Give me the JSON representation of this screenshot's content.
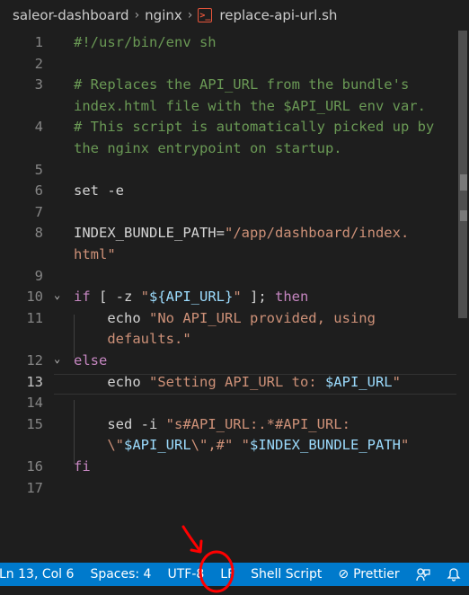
{
  "breadcrumb": {
    "folder": "saleor-dashboard",
    "subfolder": "nginx",
    "file": "replace-api-url.sh"
  },
  "editor": {
    "active_line": "13",
    "lines": [
      {
        "n": "1",
        "code": [
          {
            "t": "cm",
            "v": "#!/usr/bin/env sh"
          }
        ]
      },
      {
        "n": "2",
        "code": []
      },
      {
        "n": "3",
        "code": [
          {
            "t": "cm",
            "v": "# Replaces the API_URL from the bundle's"
          }
        ]
      },
      {
        "n": "",
        "code": [
          {
            "t": "cm",
            "v": "index.html file with the $API_URL env var."
          }
        ]
      },
      {
        "n": "4",
        "code": [
          {
            "t": "cm",
            "v": "# This script is automatically picked up by"
          }
        ]
      },
      {
        "n": "",
        "code": [
          {
            "t": "cm",
            "v": "the nginx entrypoint on startup."
          }
        ]
      },
      {
        "n": "5",
        "code": []
      },
      {
        "n": "6",
        "code": [
          {
            "t": "txt",
            "v": "set -e"
          }
        ]
      },
      {
        "n": "7",
        "code": []
      },
      {
        "n": "8",
        "code": [
          {
            "t": "txt",
            "v": "INDEX_BUNDLE_PATH="
          },
          {
            "t": "str",
            "v": "\"/app/dashboard/index."
          }
        ]
      },
      {
        "n": "",
        "code": [
          {
            "t": "str",
            "v": "html\""
          }
        ]
      },
      {
        "n": "9",
        "code": []
      },
      {
        "n": "10",
        "fold": true,
        "code": [
          {
            "t": "kw",
            "v": "if"
          },
          {
            "t": "txt",
            "v": " [ -z "
          },
          {
            "t": "str",
            "v": "\""
          },
          {
            "t": "var",
            "v": "${API_URL}"
          },
          {
            "t": "str",
            "v": "\""
          },
          {
            "t": "txt",
            "v": " ]; "
          },
          {
            "t": "kw",
            "v": "then"
          }
        ]
      },
      {
        "n": "11",
        "code": [
          {
            "t": "txt",
            "v": "    echo "
          },
          {
            "t": "str",
            "v": "\"No API_URL provided, using"
          }
        ]
      },
      {
        "n": "",
        "code": [
          {
            "t": "str",
            "v": "    defaults.\""
          }
        ]
      },
      {
        "n": "12",
        "fold": true,
        "code": [
          {
            "t": "kw",
            "v": "else"
          }
        ]
      },
      {
        "n": "13",
        "code": [
          {
            "t": "txt",
            "v": "    echo "
          },
          {
            "t": "str",
            "v": "\"Setting API_URL to: "
          },
          {
            "t": "var",
            "v": "$API_URL"
          },
          {
            "t": "str",
            "v": "\""
          }
        ]
      },
      {
        "n": "14",
        "code": []
      },
      {
        "n": "15",
        "code": [
          {
            "t": "txt",
            "v": "    sed -i "
          },
          {
            "t": "str",
            "v": "\"s#API_URL:.*#API_URL:"
          }
        ]
      },
      {
        "n": "",
        "code": [
          {
            "t": "str",
            "v": "    \\\""
          },
          {
            "t": "var",
            "v": "$API_URL"
          },
          {
            "t": "str",
            "v": "\\\",#\""
          },
          {
            "t": "txt",
            "v": " "
          },
          {
            "t": "str",
            "v": "\""
          },
          {
            "t": "var",
            "v": "$INDEX_BUNDLE_PATH"
          },
          {
            "t": "str",
            "v": "\""
          }
        ]
      },
      {
        "n": "16",
        "code": [
          {
            "t": "kw",
            "v": "fi"
          }
        ]
      },
      {
        "n": "17",
        "code": []
      }
    ]
  },
  "statusbar": {
    "position": "Ln 13, Col 6",
    "spaces": "Spaces: 4",
    "encoding": "UTF-8",
    "eol": "LF",
    "language": "Shell Script",
    "prettier": "Prettier",
    "colors": {
      "background": "#007acc",
      "annotation": "#ff0000"
    }
  }
}
